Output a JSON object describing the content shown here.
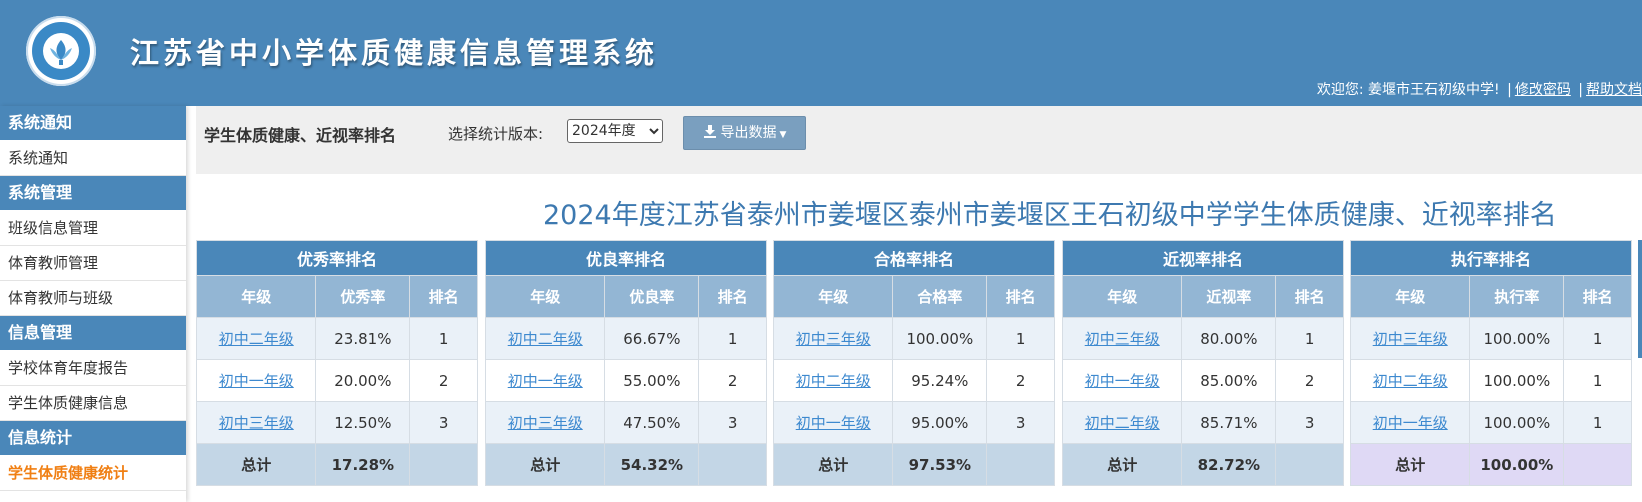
{
  "header": {
    "app_title": "江苏省中小学体质健康信息管理系统",
    "welcome": "欢迎您: 姜堰市王石初级中学!",
    "sep": "|",
    "change_password": "修改密码",
    "help": "帮助文档"
  },
  "sidebar": {
    "groups": [
      {
        "title": "系统通知",
        "items": [
          "系统通知"
        ]
      },
      {
        "title": "系统管理",
        "items": [
          "班级信息管理",
          "体育教师管理",
          "体育教师与班级"
        ]
      },
      {
        "title": "信息管理",
        "items": [
          "学校体育年度报告",
          "学生体质健康信息"
        ]
      },
      {
        "title": "信息统计",
        "items": [
          "学生体质健康统计"
        ]
      }
    ]
  },
  "toolbar": {
    "title": "学生体质健康、近视率排名",
    "version_label": "选择统计版本:",
    "version_selected": "2024年度",
    "export_label": "导出数据"
  },
  "page_heading": "2024年度江苏省泰州市姜堰区泰州市姜堰区王石初级中学学生体质健康、近视率排名",
  "colors": {
    "header_bg": "#4a87b9",
    "subheader_bg": "#93b6d4",
    "total_bg": "#c3d6e6",
    "total_bg_alt": "#dfd9f5",
    "link": "#3d89cf",
    "active": "#f07f13",
    "heading": "#3d79b0"
  },
  "icons": {
    "export": "download-icon",
    "dropdown": "caret-down-icon"
  },
  "tables": [
    {
      "caption": "优秀率排名",
      "cols": [
        "年级",
        "优秀率",
        "排名"
      ],
      "rows": [
        {
          "grade": "初中二年级",
          "rate": "23.81%",
          "rank": "1"
        },
        {
          "grade": "初中一年级",
          "rate": "20.00%",
          "rank": "2"
        },
        {
          "grade": "初中三年级",
          "rate": "12.50%",
          "rank": "3"
        }
      ],
      "total_label": "总计",
      "total_rate": "17.28%"
    },
    {
      "caption": "优良率排名",
      "cols": [
        "年级",
        "优良率",
        "排名"
      ],
      "rows": [
        {
          "grade": "初中二年级",
          "rate": "66.67%",
          "rank": "1"
        },
        {
          "grade": "初中一年级",
          "rate": "55.00%",
          "rank": "2"
        },
        {
          "grade": "初中三年级",
          "rate": "47.50%",
          "rank": "3"
        }
      ],
      "total_label": "总计",
      "total_rate": "54.32%"
    },
    {
      "caption": "合格率排名",
      "cols": [
        "年级",
        "合格率",
        "排名"
      ],
      "rows": [
        {
          "grade": "初中三年级",
          "rate": "100.00%",
          "rank": "1"
        },
        {
          "grade": "初中二年级",
          "rate": "95.24%",
          "rank": "2"
        },
        {
          "grade": "初中一年级",
          "rate": "95.00%",
          "rank": "3"
        }
      ],
      "total_label": "总计",
      "total_rate": "97.53%"
    },
    {
      "caption": "近视率排名",
      "cols": [
        "年级",
        "近视率",
        "排名"
      ],
      "rows": [
        {
          "grade": "初中三年级",
          "rate": "80.00%",
          "rank": "1"
        },
        {
          "grade": "初中一年级",
          "rate": "85.00%",
          "rank": "2"
        },
        {
          "grade": "初中二年级",
          "rate": "85.71%",
          "rank": "3"
        }
      ],
      "total_label": "总计",
      "total_rate": "82.72%"
    },
    {
      "caption": "执行率排名",
      "cols": [
        "年级",
        "执行率",
        "排名"
      ],
      "rows": [
        {
          "grade": "初中三年级",
          "rate": "100.00%",
          "rank": "1"
        },
        {
          "grade": "初中二年级",
          "rate": "100.00%",
          "rank": "1"
        },
        {
          "grade": "初中一年级",
          "rate": "100.00%",
          "rank": "1"
        }
      ],
      "total_label": "总计",
      "total_rate": "100.00%"
    }
  ]
}
